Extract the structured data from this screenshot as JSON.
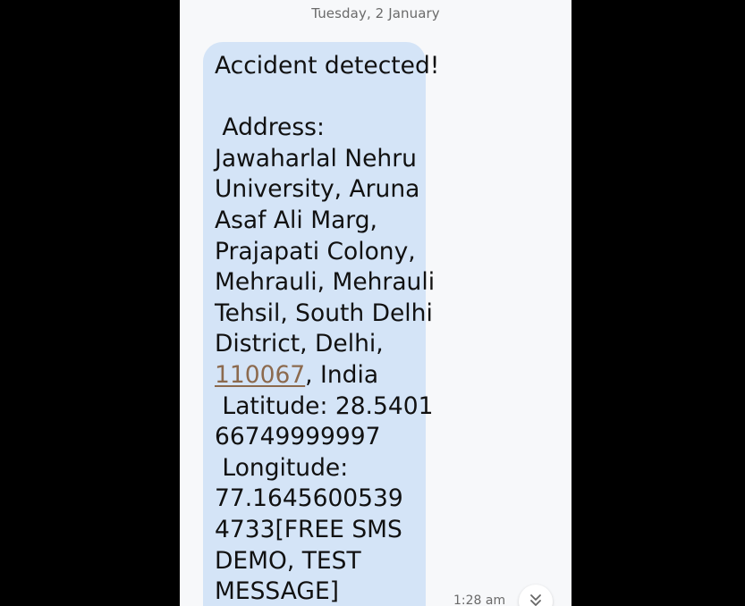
{
  "conversation": {
    "date_header": "Tuesday, 2 January"
  },
  "message": {
    "line_1": "Accident detected!",
    "line_2": " Address:",
    "line_3": "Jawaharlal Nehru",
    "line_4": "University, Aruna",
    "line_5": "Asaf Ali Marg,",
    "line_6": "Prajapati Colony,",
    "line_7": "Mehrauli, Mehrauli",
    "line_8": "Tehsil, South Delhi",
    "line_9": "District, Delhi,",
    "postal_code_link": "110067",
    "line_10_suffix": ", India",
    "line_11": " Latitude: 28.5401",
    "line_12": "66749999997",
    "line_13": " Longitude:",
    "line_14": "77.1645600539",
    "line_15": "4733[FREE SMS",
    "line_16": "DEMO, TEST",
    "line_17": "MESSAGE]",
    "timestamp": "1:28 am"
  },
  "icons": {
    "download": "download-icon"
  },
  "colors": {
    "background": "#000000",
    "screen": "#f7f8fa",
    "bubble": "#d4e4f7",
    "link": "#8c6a4e"
  }
}
